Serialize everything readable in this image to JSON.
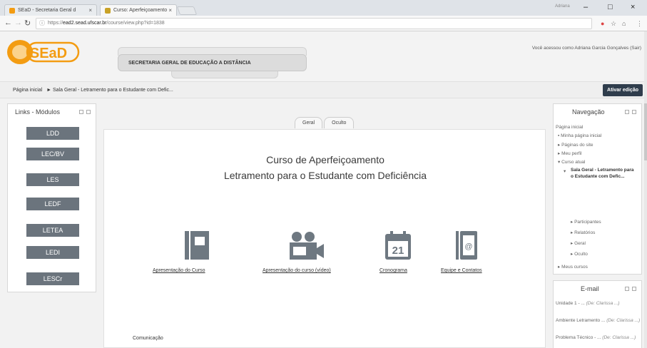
{
  "browser": {
    "tabs": [
      {
        "label": "SEaD - Secretaria Geral d",
        "active": false
      },
      {
        "label": "Curso: Aperfeiçoamento",
        "active": true
      }
    ],
    "profile_name": "Adriana",
    "url_prefix": "https://",
    "url_host": "ead2.sead.ufscar.br",
    "url_path": "/course/view.php?id=1838",
    "window_controls": [
      "–",
      "□",
      "×"
    ]
  },
  "header": {
    "logo_text": "SEaD",
    "secretaria": "SECRETARIA GERAL DE EDUCAÇÃO A DISTÂNCIA",
    "login_info": "Você acessou como Adriana Garcia Gonçalves (Sair)"
  },
  "breadcrumb": {
    "home": "Página inicial",
    "separator": "►",
    "current": "Sala Geral - Letramento para o Estudante com Defic..."
  },
  "edit_button": "Ativar edição",
  "links_block": {
    "title": "Links - Módulos",
    "buttons": [
      "LDD",
      "LEC/BV",
      "LES",
      "LEDF",
      "LETEA",
      "LEDI",
      "LESCr"
    ]
  },
  "center": {
    "tabs": [
      "Geral",
      "Oculto"
    ],
    "title_line1": "Curso de Aperfeiçoamento",
    "title_line2": "Letramento para o Estudante com Deficiência",
    "icons": [
      {
        "name": "book-icon",
        "label": "Apresentação do Curso"
      },
      {
        "name": "video-camera-icon",
        "label": "Apresentação do curso (vídeo)"
      },
      {
        "name": "calendar-icon",
        "label": "Cronograma",
        "day": "21"
      },
      {
        "name": "contacts-icon",
        "label": "Equipe e Contatos"
      }
    ],
    "section_label": "Comunicação"
  },
  "navigation": {
    "title": "Navegação",
    "items": {
      "home": "Página inicial",
      "my_home": "Minha página inicial",
      "site_pages": "Páginas do site",
      "profile": "Meu perfil",
      "current_course": "Curso atual",
      "course_name": "Sala Geral - Letramento para o Estudante com Defic...",
      "participants": "Participantes",
      "reports": "Relatórios",
      "general": "Geral",
      "hidden": "Oculto",
      "my_courses": "Meus cursos"
    }
  },
  "email": {
    "title": "E-mail",
    "items": [
      {
        "subject": "Unidade 1 - ...",
        "from": "(De: Clarissa ...)"
      },
      {
        "subject": "Ambiente Letramento ...",
        "from": "(De: Clarissa ...)"
      },
      {
        "subject": "Problema Técnico - ...",
        "from": "(De: Clarissa ...)"
      }
    ]
  },
  "colors": {
    "logo_orange": "#f39c12",
    "module_button": "#6b747d",
    "edit_button": "#2f3d4c",
    "icon_gray": "#6e7881"
  }
}
